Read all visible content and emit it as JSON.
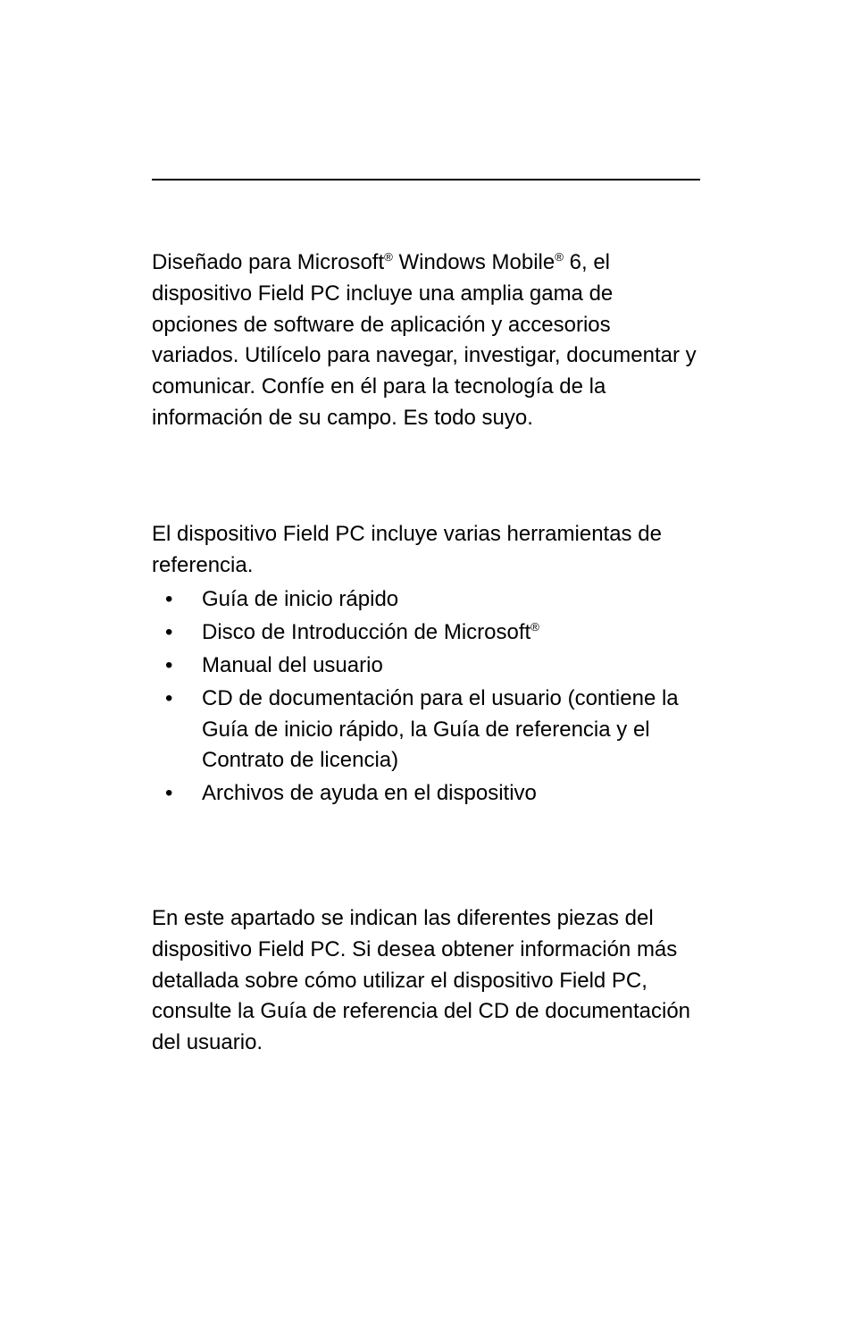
{
  "intro": {
    "prefix": "Diseñado para Microsoft",
    "reg1": "®",
    "mid1": " Windows Mobile",
    "reg2": "®",
    "suffix": " 6, el dispositivo Field PC incluye una amplia gama de opciones de software de aplicación y accesorios variados. Utilícelo para navegar, investigar, documentar y comunicar. Confíe en él para la tecnología de la información de su campo. Es todo suyo."
  },
  "listIntro": "El dispositivo Field PC incluye varias herramientas de referencia.",
  "bullets": {
    "item1": "Guía de inicio rápido",
    "item2_prefix": "Disco de Introducción de Microsoft",
    "item2_reg": "®",
    "item3": "Manual del usuario",
    "item4": "CD de documentación para el usuario (contiene la Guía de inicio rápido, la Guía de referencia y el Contrato de licencia)",
    "item5": "Archivos de ayuda en el dispositivo"
  },
  "final": "En este apartado se indican las diferentes piezas del dispositivo Field PC. Si desea obtener información más detallada sobre cómo utilizar el dispositivo Field PC, consulte la Guía de referencia del CD de documentación del usuario."
}
